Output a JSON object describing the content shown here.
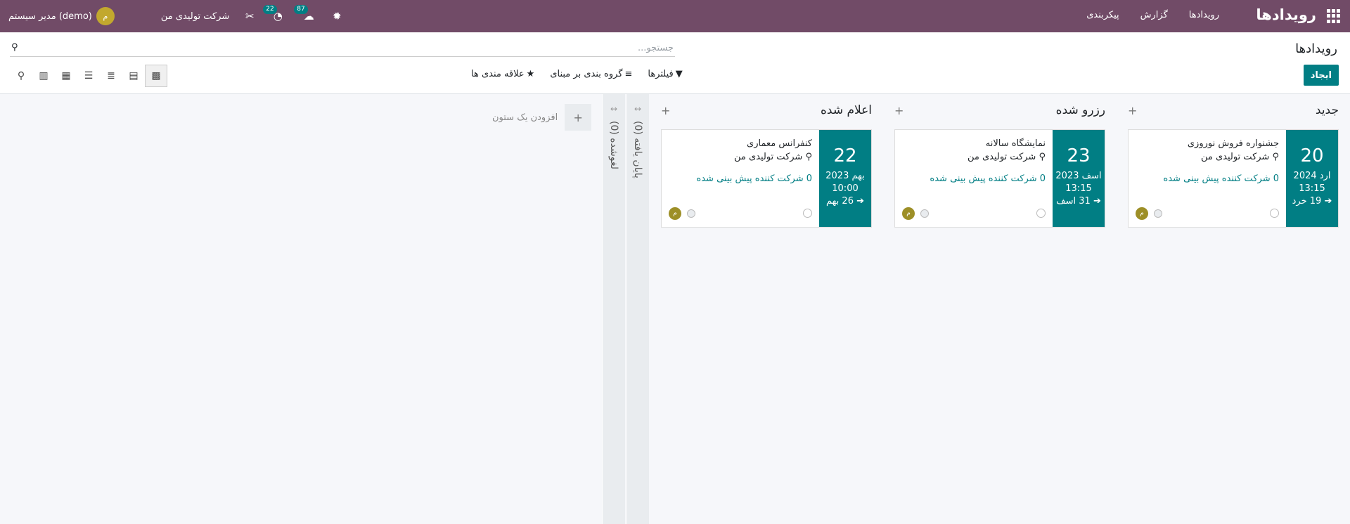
{
  "navbar": {
    "brand": "رویدادها",
    "menu": [
      "رویدادها",
      "گزارش",
      "پیکربندی"
    ],
    "user_name": "مدیر سیستم (demo)",
    "user_initial": "م",
    "company": "شرکت تولیدی من",
    "activity_count": "22",
    "messages_count": "87"
  },
  "control_panel": {
    "title": "رویدادها",
    "search_placeholder": "جستجو...",
    "create_label": "ایجاد",
    "filters_label": "فیلترها",
    "groupby_label": "گروه بندی بر مبنای",
    "favorites_label": "علاقه مندی ها"
  },
  "columns": [
    {
      "title": "جدید",
      "card": {
        "day": "20",
        "month_year": "ارد 2024",
        "time": "13:15",
        "end": "19 خرد",
        "name": "جشنواره فروش نوروزی",
        "location": "شرکت تولیدی من",
        "attendees": "0 شرکت کننده پیش بینی شده",
        "initial": "م"
      }
    },
    {
      "title": "رزرو شده",
      "card": {
        "day": "23",
        "month_year": "اسف 2023",
        "time": "13:15",
        "end": "31 اسف",
        "name": "نمایشگاه سالانه",
        "location": "شرکت تولیدی من",
        "attendees": "0 شرکت کننده پیش بینی شده",
        "initial": "م"
      }
    },
    {
      "title": "اعلام شده",
      "card": {
        "day": "22",
        "month_year": "بهم 2023",
        "time": "10:00",
        "end": "26 بهم",
        "name": "کنفرانس معماری",
        "location": "شرکت تولیدی من",
        "attendees": "0 شرکت کننده پیش بینی شده",
        "initial": "م"
      }
    }
  ],
  "folded_columns": [
    "پایان یافته (0)",
    "لغوشده (0)"
  ],
  "add_column_label": "افزودن یک ستون"
}
